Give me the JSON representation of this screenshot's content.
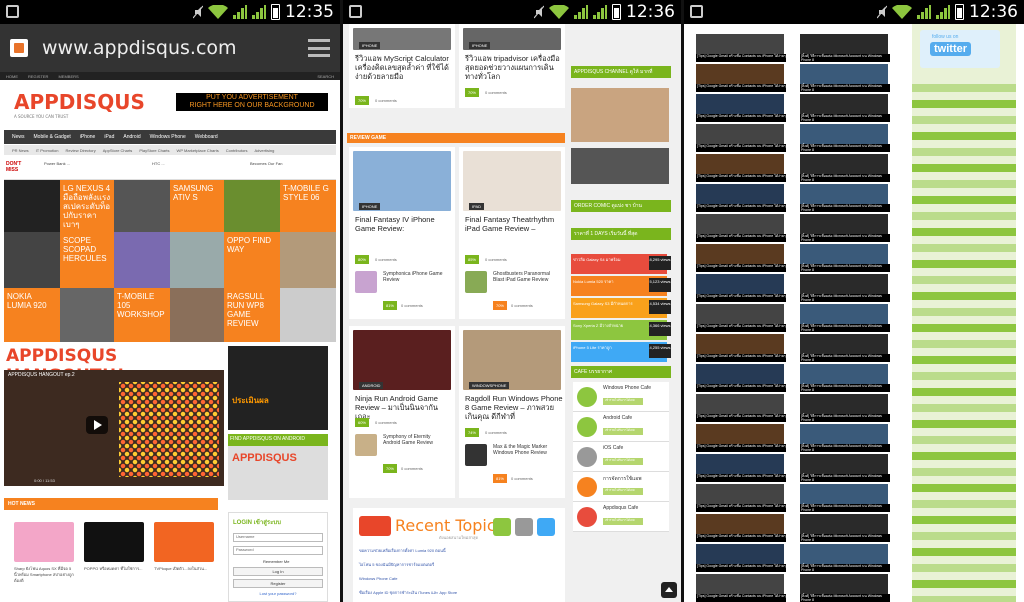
{
  "status": {
    "time": "12:35",
    "time_p2": "12:36",
    "time_p3": "12:36"
  },
  "browser": {
    "url": "www.appdisqus.com"
  },
  "p1": {
    "topnav": [
      "HOME",
      "REGISTER",
      "MEMBERS"
    ],
    "search_label": "SEARCH",
    "logo": "APPDISQUS",
    "logo_tag": "A SOURCE YOU CAN TRUST",
    "ad_line1": "PUT YOU ADVERTISEMENT",
    "ad_line2": "RIGHT HERE ON OUR BACKGROUND",
    "nav": [
      "News",
      "Mobile & Gadget",
      "iPhone",
      "iPad",
      "Android",
      "Windows Phone",
      "Webboard"
    ],
    "subnav": [
      "PR News",
      "IT Promotion",
      "Review Directory",
      "AppStore Charts",
      "PlayStore Charts",
      "WP Marketplace Charts",
      "Contributors",
      "Advertising"
    ],
    "dont_miss": "DON'T MISS",
    "becomes_fan": "Becomes Our Fan",
    "tiles": [
      "LG NEXUS 4 มือถือพลังแรง สเปคระดับท็อปกับราคาเบาๆ",
      "SAMSUNG ATIV S",
      "T-MOBILE G STYLE 06",
      "SCOPE SCOPAD HERCULES",
      "OPPO FIND WAY",
      "NOKIA LUMIA 920",
      "T-MOBILE 105 WORKSHOP",
      "RAGSULL RUN WP8 GAME REVIEW"
    ],
    "hangout": "APPDISQUS HANGOUT!!!",
    "video_title": "APPDISQUS HANGOUT ep.2",
    "video_time": "0:00 / 11:53",
    "side_ad_text": "ประเมินผล",
    "find_android": "FIND APPDISQUS ON ANDROID",
    "android_logo": "APPDISQUS",
    "hot_news": "HOT NEWS",
    "hot_items": [
      "Sharp ยังโฟน Aquos SX ที่มีจอ 5 นิ้วพร้อม Smartphone สปาอย่างถูกต้องดี",
      "POPPO หรือหมดค่า ที่ไม่ใช่การ...",
      "TVPloque เปิดตัว...ลงในส่วน..."
    ],
    "login_title": "LOGIN เข้าสู่ระบบ",
    "username": "Username",
    "password": "Password",
    "remember": "Remember Me",
    "login_btn": "Log In",
    "register_btn": "Register",
    "lost_pw": "Lost your password?"
  },
  "p2": {
    "cards_top": [
      {
        "badge": "IPHONE",
        "title": "รีวิวแอพ MyScript Calculator เครื่องคิดเลขสุดล้ำค่า ที่ใช้ได้ง่ายด้วยลายมือ",
        "score": "70%",
        "comments": "0 comments"
      },
      {
        "badge": "IPHONE",
        "title": "รีวิวแอพ tripadvisor เครื่องมือสุดยอดช่วยวางแผนการเดินทางทั่วโลก",
        "score": "70%",
        "comments": "0 comments"
      }
    ],
    "review_bar": "REVIEW GAME",
    "games": [
      {
        "badge": "IPHONE",
        "title": "Final Fantasy IV iPhone Game Review:",
        "score": "80%",
        "comments": "0 comments"
      },
      {
        "badge": "IPAD",
        "title": "Final Fantasy Theatrhythm iPad Game Review –",
        "score": "85%",
        "comments": "0 comments"
      },
      {
        "badge": "ANDROID",
        "title": "Ninja Run Android Game Review – มาเป็นนินจากันเถอะ",
        "score": "60%",
        "comments": "0 comments"
      },
      {
        "badge": "WINDOWSPHONE",
        "title": "Ragdoll Run Windows Phone 8 Game Review – ภาพสวยเกินคุณ ดีกีฬาที่",
        "score": "74%",
        "comments": "0 comments"
      }
    ],
    "minis": [
      {
        "title": "Symphonica iPhone Game Review",
        "score": "81%",
        "comments": "0 comments"
      },
      {
        "title": "Ghostbusters Paranormal Blast iPad Game Review",
        "score": "70%",
        "comments": "0 comments"
      },
      {
        "title": "Symphony of Eternity Android Game Review",
        "score": "70%",
        "comments": "0 comments"
      },
      {
        "title": "Max & the Magic Marker Windows Phone Review",
        "score": "81%",
        "comments": "0 comments"
      }
    ],
    "right_headers": [
      "APPDISQUS CHANNEL ดูให้ มากที่",
      "ORDER COMIC ดูแบ่ง ชา บ้าน",
      "ราคาที่ 1 DAYS เริ่มวันนี้ ที่สุด"
    ],
    "popular": [
      {
        "text": "ข่าวลือ Galaxy S4 มาพร้อม",
        "views": "8,295 views"
      },
      {
        "text": "Nokia Lumia 520 ราคา",
        "views": "5,123 views"
      },
      {
        "text": "Samsung Galaxy S3 มีกำหนดการ",
        "views": "4,534 views"
      },
      {
        "text": "Sony Xperia Z มีวางจำหน่าย",
        "views": "4,366 views"
      },
      {
        "text": "iPhone 5 Lite ราคาถูก",
        "views": "4,255 views"
      }
    ],
    "cafe_header": "CAFE บรรยากาศ",
    "cafes": [
      "Windows Phone Cafe",
      "Android Cafe",
      "iOS Cafe",
      "การจัดการใช้แอพ",
      "Appdisqus Cafe"
    ],
    "cafe_btn": "เข้าร่วมไปกับเราได้เลย",
    "recent": "Recent Topics",
    "recent_sub": "ดังนอยสนามใหม่ล่าสุด",
    "recent_rows": [
      "ขอความช่วยเหลือเรื่องการตั้งค่า Lumia 920 ตอนนี้",
      "ไอโฟน 5 ของฉันมีปัญหาการชาร์จแบตเตอรี่",
      "Windows Phone Cafe",
      "ชื่อเรื่อง Apple ID ชุดการชำระเงิน iTunes และ App Store"
    ]
  },
  "p3": {
    "twitter_label": "follow us on",
    "twitter_brand": "twitter",
    "row_labels": [
      "[Tips] Google Gmail สร้างชื่อ Contacts บน iPhone ได้ง่ายๆ",
      "[ลิ้งค์] วิธีการเชื่อมต่อ Microsoft Account บน Windows Phone 8"
    ]
  }
}
